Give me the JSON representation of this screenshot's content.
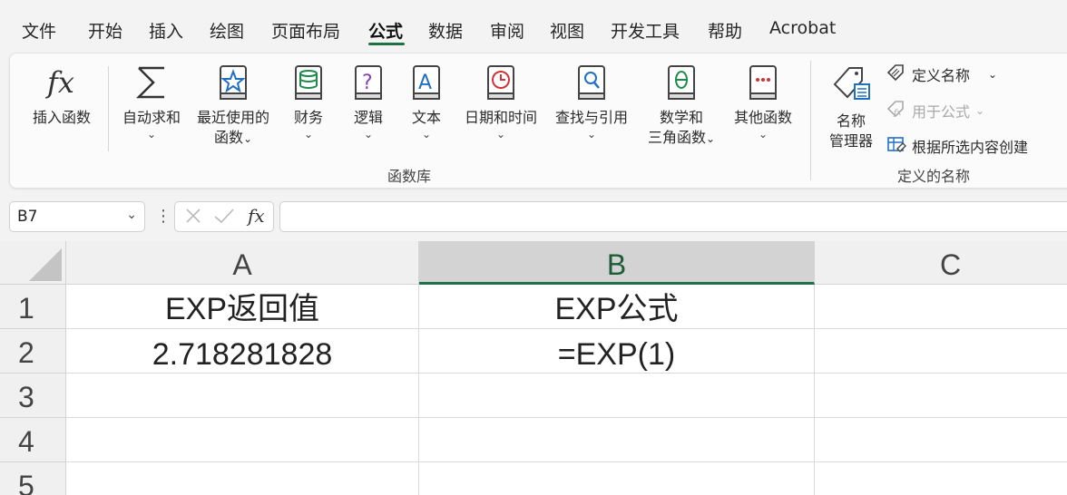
{
  "tabs": [
    {
      "label": "文件"
    },
    {
      "label": "开始"
    },
    {
      "label": "插入"
    },
    {
      "label": "绘图"
    },
    {
      "label": "页面布局"
    },
    {
      "label": "公式"
    },
    {
      "label": "数据"
    },
    {
      "label": "审阅"
    },
    {
      "label": "视图"
    },
    {
      "label": "开发工具"
    },
    {
      "label": "帮助"
    },
    {
      "label": "Acrobat"
    }
  ],
  "active_tab": "公式",
  "ribbon": {
    "function_library": {
      "group_label": "函数库",
      "insert_function": "插入函数",
      "autosum": "自动求和",
      "recent_line1": "最近使用的",
      "recent_line2": "函数",
      "financial": "财务",
      "logical": "逻辑",
      "text": "文本",
      "datetime": "日期和时间",
      "lookup": "查找与引用",
      "math_line1": "数学和",
      "math_line2": "三角函数",
      "other": "其他函数"
    },
    "defined_names": {
      "group_label": "定义的名称",
      "name_manager_line1": "名称",
      "name_manager_line2": "管理器",
      "define_name": "定义名称",
      "use_in_formula": "用于公式",
      "create_from_selection": "根据所选内容创建"
    }
  },
  "formula_bar": {
    "name_box": "B7",
    "formula": ""
  },
  "grid": {
    "columns": [
      "A",
      "B",
      "C"
    ],
    "selected_column": "B",
    "rows": [
      "1",
      "2",
      "3",
      "4",
      "5"
    ],
    "cells": {
      "A1": "EXP返回值",
      "B1": "EXP公式",
      "A2": "2.718281828",
      "B2": "=EXP(1)"
    }
  },
  "colors": {
    "accent": "#1e7145",
    "ribbon_bg": "#fbfbfb",
    "app_bg": "#f3f3f3"
  }
}
